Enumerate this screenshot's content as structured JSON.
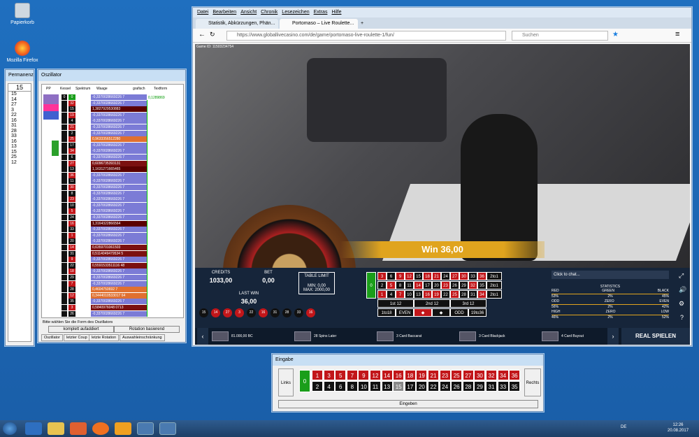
{
  "desktop": {
    "icons": [
      {
        "label": "Papierkorb",
        "icon": "recycle-bin-icon"
      },
      {
        "label": "Mozilla Firefox",
        "icon": "firefox-icon"
      }
    ]
  },
  "permanenz": {
    "title": "Permanenz",
    "current": "15",
    "numbers": [
      "15",
      "14",
      "27",
      "3",
      "22",
      "16",
      "31",
      "28",
      "33",
      "16",
      "13",
      "15",
      "25",
      "12"
    ]
  },
  "oszillator": {
    "title": "Oszillator",
    "headers": [
      "PP",
      "Kessel",
      "Spektrum",
      "Waage",
      "grafisch",
      "Textform"
    ],
    "first_value": "0,1289869",
    "rows": [
      {
        "a": "0",
        "b": "0",
        "c": "g",
        "val": "-0,3370028669226 7",
        "vc": "#7b7bd6"
      },
      {
        "a": "32",
        "b": "",
        "c": "r",
        "val": "-0,3370028669226 7",
        "vc": "#7b7bd6"
      },
      {
        "a": "15",
        "b": "",
        "c": "b",
        "val": "1,3827929530883",
        "vc": "#5a0000"
      },
      {
        "a": "19",
        "b": "",
        "c": "r",
        "val": "-0,3370028669226 7",
        "vc": "#7b7bd6"
      },
      {
        "a": "4",
        "b": "",
        "c": "b",
        "val": "-0,3370028669226 7",
        "vc": "#7b7bd6"
      },
      {
        "a": "21",
        "b": "",
        "c": "r",
        "val": "-0,3370028669226 7",
        "vc": "#7b7bd6"
      },
      {
        "a": "2",
        "b": "",
        "c": "b",
        "val": "-0,3370028669226 7",
        "vc": "#7b7bd6"
      },
      {
        "a": "25",
        "b": "",
        "c": "r",
        "val": "0,9633356512280",
        "vc": "#e07030"
      },
      {
        "a": "17",
        "b": "",
        "c": "b",
        "val": "-0,3370028669226 7",
        "vc": "#7b7bd6"
      },
      {
        "a": "34",
        "b": "",
        "c": "r",
        "val": "-0,3370028669226 7",
        "vc": "#7b7bd6"
      },
      {
        "a": "6",
        "b": "",
        "c": "b",
        "val": "-0,3370028669226 7",
        "vc": "#7b7bd6"
      },
      {
        "a": "27",
        "b": "",
        "c": "r",
        "val": "0,6096735393131",
        "vc": "#7b1010"
      },
      {
        "a": "13",
        "b": "",
        "c": "b",
        "val": "1,1631271665465",
        "vc": "#5a0000"
      },
      {
        "a": "36",
        "b": "",
        "c": "r",
        "val": "-0,3370028669226 7",
        "vc": "#7b7bd6"
      },
      {
        "a": "11",
        "b": "",
        "c": "b",
        "val": "-0,3370028669226 7",
        "vc": "#7b7bd6"
      },
      {
        "a": "30",
        "b": "",
        "c": "r",
        "val": "-0,3370028669226 7",
        "vc": "#7b7bd6"
      },
      {
        "a": "8",
        "b": "",
        "c": "b",
        "val": "-0,3370028669226 7",
        "vc": "#7b7bd6"
      },
      {
        "a": "23",
        "b": "",
        "c": "r",
        "val": "-0,3370028669226 7",
        "vc": "#7b7bd6"
      },
      {
        "a": "10",
        "b": "",
        "c": "b",
        "val": "-0,3370028669226 7",
        "vc": "#7b7bd6"
      },
      {
        "a": "5",
        "b": "",
        "c": "r",
        "val": "-0,3370028669226 7",
        "vc": "#7b7bd6"
      },
      {
        "a": "24",
        "b": "",
        "c": "b",
        "val": "-0,3370028669226 7",
        "vc": "#7b7bd6"
      },
      {
        "a": "16",
        "b": "",
        "c": "r",
        "val": "1,3164322866564",
        "vc": "#5a0000"
      },
      {
        "a": "33",
        "b": "",
        "c": "b",
        "val": "-0,3370028669226 7",
        "vc": "#7b7bd6"
      },
      {
        "a": "1",
        "b": "",
        "c": "r",
        "val": "-0,3370028669226 7",
        "vc": "#7b7bd6"
      },
      {
        "a": "20",
        "b": "",
        "c": "b",
        "val": "-0,3370028669226 7",
        "vc": "#7b7bd6"
      },
      {
        "a": "14",
        "b": "",
        "c": "r",
        "val": "0,6359701061503",
        "vc": "#7b1010"
      },
      {
        "a": "31",
        "b": "",
        "c": "b",
        "val": "0,5114049479534 5",
        "vc": "#7b1010"
      },
      {
        "a": "9",
        "b": "",
        "c": "r",
        "val": "-0,3370028669226 7",
        "vc": "#7b7bd6"
      },
      {
        "a": "22",
        "b": "",
        "c": "b",
        "val": "0,5591533511116 48",
        "vc": "#7b1010"
      },
      {
        "a": "18",
        "b": "",
        "c": "r",
        "val": "-0,3370028669226 7",
        "vc": "#7b7bd6"
      },
      {
        "a": "29",
        "b": "",
        "c": "b",
        "val": "-0,3370028669226 7",
        "vc": "#7b7bd6"
      },
      {
        "a": "7",
        "b": "",
        "c": "r",
        "val": "-0,3370028669226 7",
        "vc": "#7b7bd6"
      },
      {
        "a": "28",
        "b": "",
        "c": "b",
        "val": "0,4604750692 7",
        "vc": "#e07030"
      },
      {
        "a": "12",
        "b": "",
        "c": "r",
        "val": "0,3444010533017 64",
        "vc": "#e07030"
      },
      {
        "a": "35",
        "b": "",
        "c": "b",
        "val": "-0,3370028669226 7",
        "vc": "#7b7bd6"
      },
      {
        "a": "3",
        "b": "",
        "c": "r",
        "val": "0,5840976048 0713",
        "vc": "#7b1010"
      },
      {
        "a": "26",
        "b": "",
        "c": "b",
        "val": "-0,3370028669226 7",
        "vc": "#7b7bd6"
      }
    ],
    "choose_label": "Bitte wählen Sie die Form des Oszillators",
    "btn_left": "komplett aufaddiert",
    "btn_right": "Rotation basierend",
    "tabs": [
      "Oszillator",
      "letzter Coup",
      "letzte Rotation",
      "Auswahleinschränkung"
    ]
  },
  "browser": {
    "menu": [
      "Datei",
      "Bearbeiten",
      "Ansicht",
      "Chronik",
      "Lesezeichen",
      "Extras",
      "Hilfe"
    ],
    "tabs": [
      "Statistik, Abkürzungen, Phän...",
      "Portomaso – Live Roulette..."
    ],
    "url": "https://www.globallivecasino.com/de/game/portomaso-live-roulette-1/fun/",
    "search_placeholder": "Suchen",
    "game_id": "Game ID: 11503234754"
  },
  "casino": {
    "win_text": "Win 36,00",
    "credits_label": "CREDITS",
    "credits_value": "1033,00",
    "bet_label": "BET",
    "bet_value": "0,00",
    "lastwin_label": "LAST WIN",
    "lastwin_value": "36,00",
    "table_limit_label": "TABLE LIMIT",
    "min_label": "MIN: 0,00",
    "max_label": "MAX: 2000,00",
    "recent": [
      {
        "n": "15",
        "c": "b"
      },
      {
        "n": "14",
        "c": "r"
      },
      {
        "n": "27",
        "c": "r"
      },
      {
        "n": "3",
        "c": "r"
      },
      {
        "n": "22",
        "c": "b"
      },
      {
        "n": "16",
        "c": "r"
      },
      {
        "n": "31",
        "c": "b"
      },
      {
        "n": "28",
        "c": "b"
      },
      {
        "n": "33",
        "c": "b"
      },
      {
        "n": "16",
        "c": "r"
      }
    ],
    "dozens": [
      "1st 12",
      "2nd 12",
      "3rd 12"
    ],
    "outside": [
      "1to18",
      "EVEN",
      "ODD",
      "19to36"
    ],
    "row_label": "2to1",
    "chat_placeholder": "Click to chat...",
    "stats": {
      "title": "STATISTICS",
      "rows": [
        [
          "RED",
          "GREEN",
          "BLACK"
        ],
        [
          "53%",
          "2%",
          "45%"
        ],
        [
          "ODD",
          "ZERO",
          "EVEN"
        ],
        [
          "56%",
          "2%",
          "42%"
        ],
        [
          "HIGH",
          "ZERO",
          "LOW"
        ],
        [
          "46%",
          "2%",
          "52%"
        ]
      ]
    },
    "games": [
      "81.000,00 BC",
      "28 Spins Later",
      "3 Card Baccarat",
      "3 Card Blackjack",
      "4 Card Buyout"
    ],
    "real_button": "REAL SPIELEN"
  },
  "eingabe": {
    "title": "Eingabe",
    "links": "Links",
    "rechts": "Rechts",
    "top_row": [
      "1",
      "3",
      "5",
      "7",
      "9",
      "12",
      "14",
      "16",
      "18",
      "19",
      "21",
      "23",
      "25",
      "27",
      "30",
      "32",
      "34",
      "36"
    ],
    "bottom_row": [
      "2",
      "4",
      "6",
      "8",
      "10",
      "11",
      "13",
      "15",
      "17",
      "20",
      "22",
      "24",
      "26",
      "28",
      "29",
      "31",
      "33",
      "35"
    ],
    "zero": "0",
    "button": "Eingeben"
  },
  "taskbar": {
    "lang": "DE",
    "time": "12:26",
    "date": "20.08.2017"
  }
}
